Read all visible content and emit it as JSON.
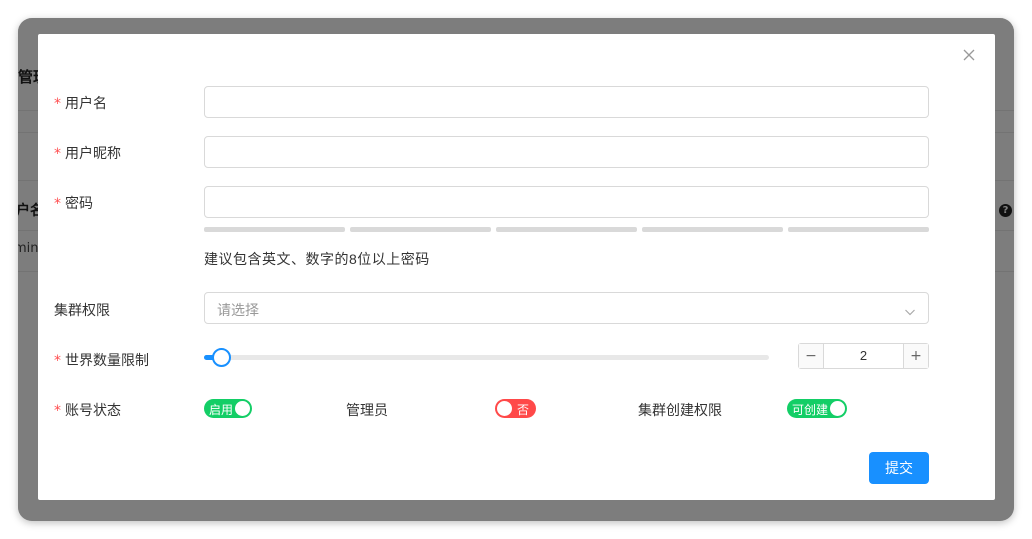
{
  "background": {
    "title": "管理",
    "column_header": "户名",
    "cell_value": "mini"
  },
  "modal": {
    "fields": {
      "username": {
        "label": "用户名",
        "required_mark": "*",
        "value": ""
      },
      "nickname": {
        "label": "用户昵称",
        "required_mark": "*",
        "value": ""
      },
      "password": {
        "label": "密码",
        "required_mark": "*",
        "value": "",
        "hint": "建议包含英文、数字的8位以上密码"
      },
      "cluster_permission": {
        "label": "集群权限",
        "placeholder": "请选择"
      },
      "world_limit": {
        "label": "世界数量限制",
        "required_mark": "*",
        "value": "2",
        "slider_fraction": 0.02
      },
      "account_status": {
        "label": "账号状态",
        "required_mark": "*",
        "switch_text": "启用",
        "on": true
      },
      "admin": {
        "label": "管理员",
        "switch_text": "否",
        "on": false
      },
      "cluster_create": {
        "label": "集群创建权限",
        "switch_text": "可创建",
        "on": true
      }
    },
    "stepper": {
      "minus": "−",
      "plus": "+"
    },
    "submit_label": "提交"
  },
  "colors": {
    "primary": "#1890ff",
    "switch_on": "#13ce66",
    "switch_off": "#ff4949",
    "required": "#ff4d4f"
  }
}
